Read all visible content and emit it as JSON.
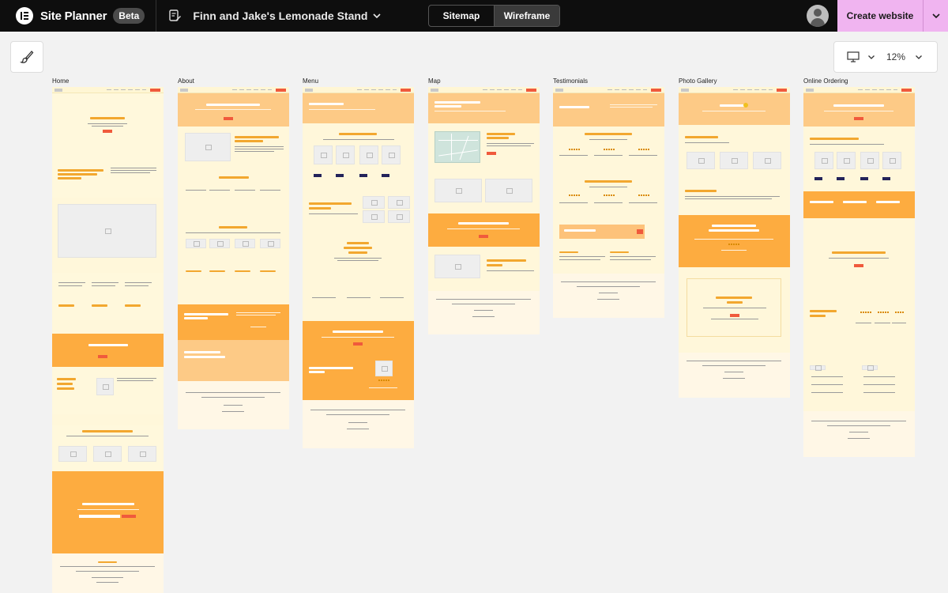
{
  "app": {
    "name": "Site Planner",
    "badge": "Beta",
    "project_title": "Finn and Jake's Lemonade Stand"
  },
  "view_toggle": {
    "options": [
      "Sitemap",
      "Wireframe"
    ],
    "active": "Wireframe"
  },
  "actions": {
    "create_label": "Create website"
  },
  "zoom": {
    "value": "12%"
  },
  "pages": [
    {
      "label": "Home"
    },
    {
      "label": "About"
    },
    {
      "label": "Menu"
    },
    {
      "label": "Map"
    },
    {
      "label": "Testimonials"
    },
    {
      "label": "Photo Gallery"
    },
    {
      "label": "Online Ordering"
    }
  ],
  "colors": {
    "topbar": "#0e0e0e",
    "create_button": "#f0b4f0",
    "page_bg": "#fff7da",
    "peach": "#fdca86",
    "orange": "#fdac40",
    "accent_button": "#f05a3c",
    "heading": "#f2a72f"
  },
  "icons": {
    "logo": "elementor-logo-icon",
    "document": "document-edit-icon",
    "project_dropdown": "chevron-down-icon",
    "account": "user-avatar-icon",
    "create_dropdown": "chevron-down-icon",
    "brush": "paint-brush-icon",
    "device": "desktop-monitor-icon"
  }
}
